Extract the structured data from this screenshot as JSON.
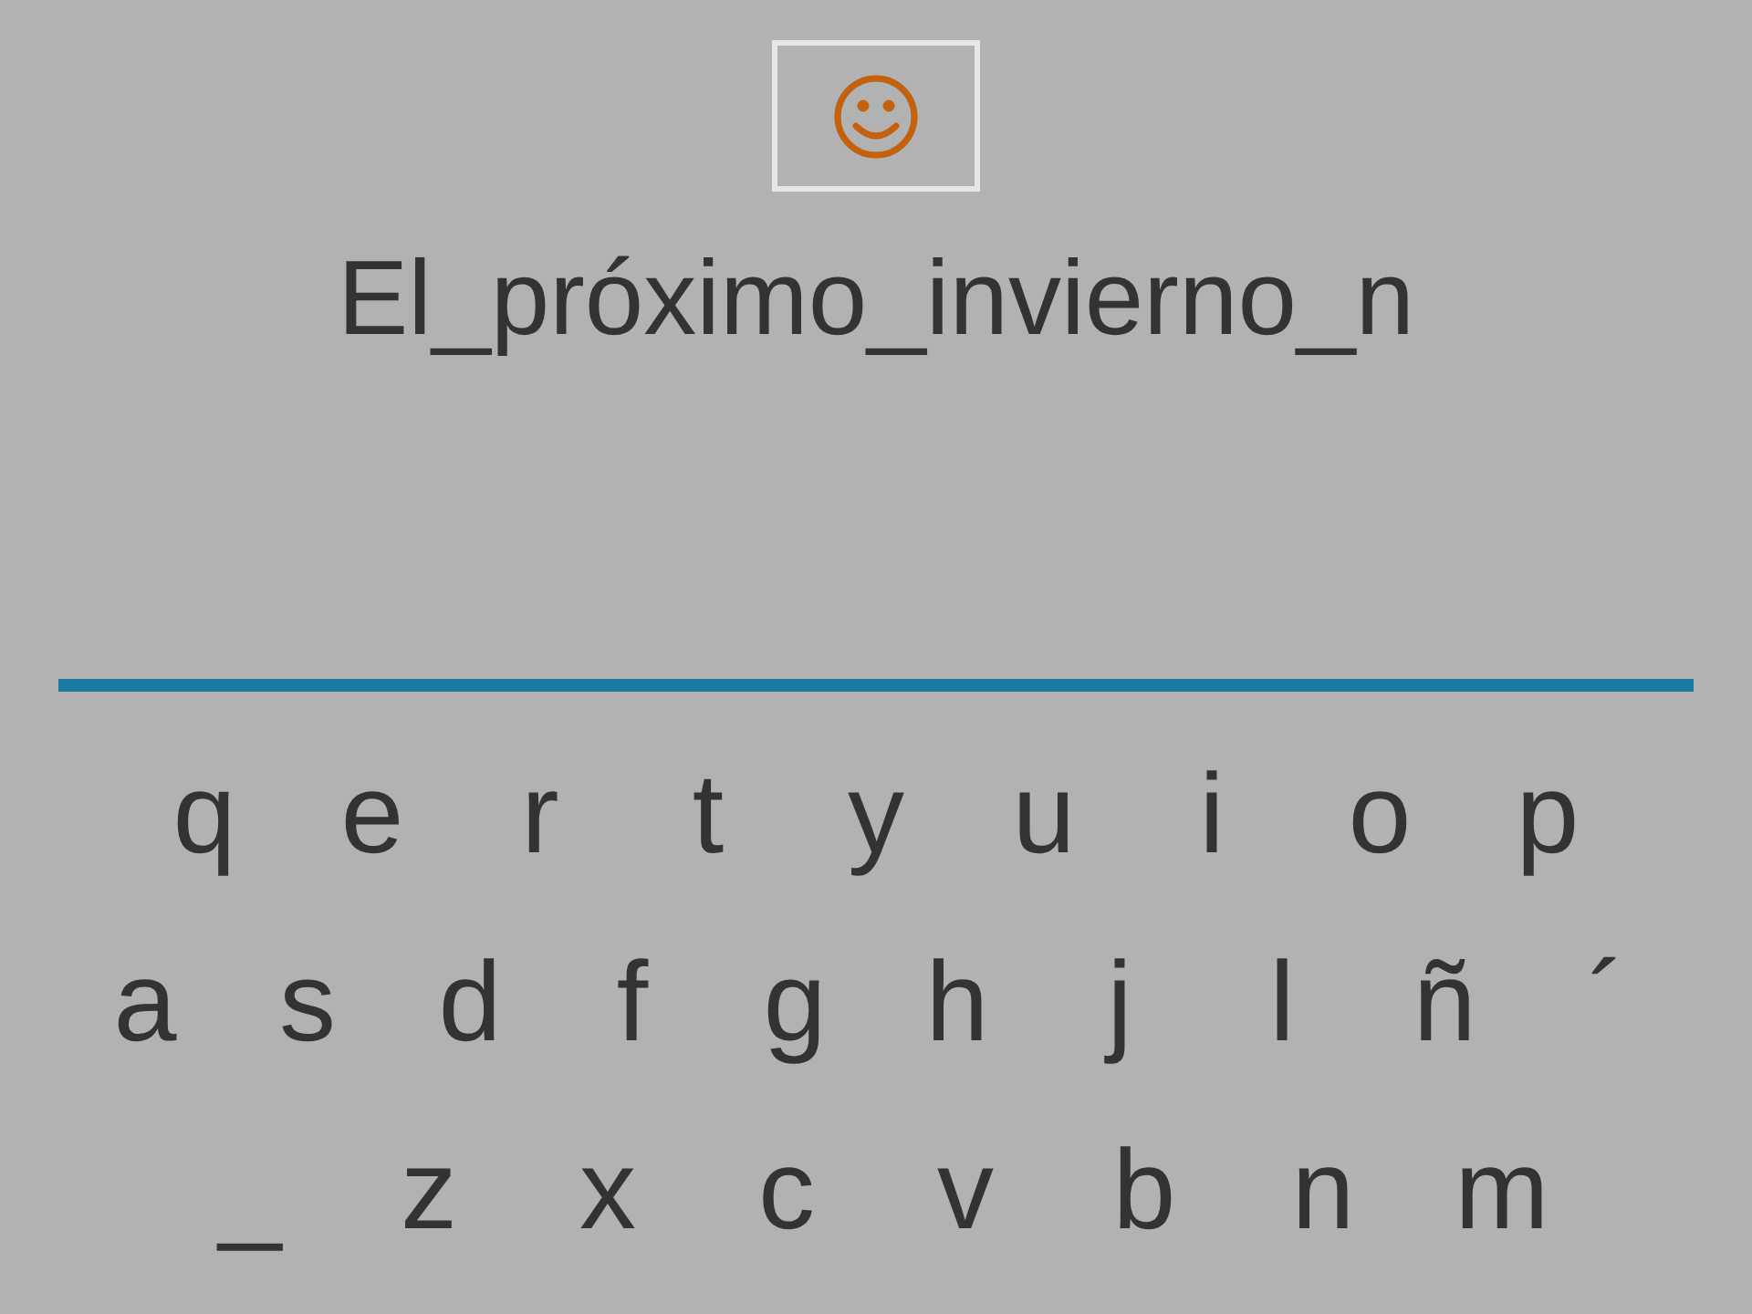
{
  "phrase": "El_próximo_invierno_n",
  "keyboard": {
    "rows": [
      [
        "q",
        "e",
        "r",
        "t",
        "y",
        "u",
        "i",
        "o",
        "p"
      ],
      [
        "a",
        "s",
        "d",
        "f",
        "g",
        "h",
        "j",
        "l",
        "ñ",
        "´"
      ],
      [
        "_",
        "z",
        "x",
        "c",
        "v",
        "b",
        "n",
        "m"
      ]
    ]
  }
}
